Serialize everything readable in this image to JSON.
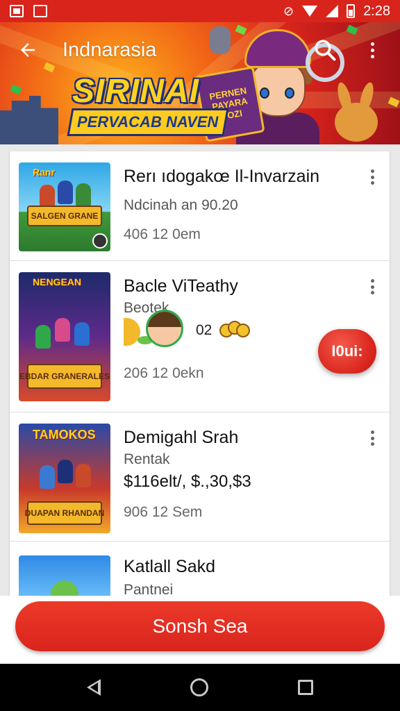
{
  "status_bar": {
    "time": "2:28"
  },
  "toolbar": {
    "title": "Indnarasia"
  },
  "banner": {
    "headline": "SIRINAI",
    "ribbon": "PERVACAB NAVEN",
    "book_text": "PERNEN PAYARA POZI"
  },
  "items": [
    {
      "title": "Rerı ıdogakœ Il-Invarzain",
      "subtitle": "Ndcinah an 90.20",
      "time": "406 12 0em",
      "thumb_tag": "Ranr",
      "thumb_banner": "SALGEN GRANE"
    },
    {
      "title": "Bacle ViTeathy",
      "subtitle": "Beotek",
      "trade_value": "02",
      "time": "206 12 0ekn",
      "thumb_tag": "NENGEAN",
      "thumb_banner": "EBDAR GRANERALES"
    },
    {
      "title": "Demigahl Srah",
      "subtitle": "Rentak",
      "price": "$116elt/, $.,30,$3",
      "time": "906 12 Sem",
      "thumb_tag": "TAMOKOS",
      "thumb_banner": "DUAPAN RHANDAN"
    },
    {
      "title": "Katlall Sakd",
      "subtitle": "Pantnei"
    }
  ],
  "fab": {
    "label": "I0ui:"
  },
  "primary_button": {
    "label": "Sonsh Sea"
  },
  "colors": {
    "primary": "#d9241c",
    "accent": "#ffd21f",
    "fab": "#e5322a"
  }
}
